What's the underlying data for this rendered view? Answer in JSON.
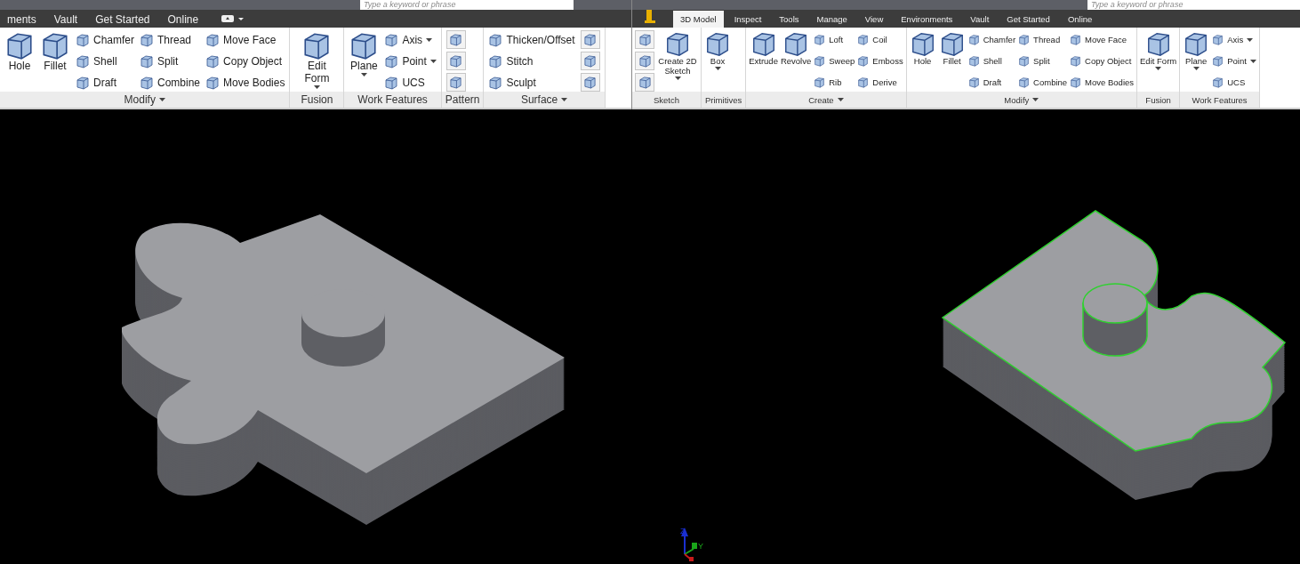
{
  "ribbons": [
    {
      "search": {
        "placeholder": "Type a keyword or phrase"
      },
      "tabs": [
        {
          "label": "ments",
          "selected": false
        },
        {
          "label": "Vault",
          "selected": false
        },
        {
          "label": "Get Started",
          "selected": false
        },
        {
          "label": "Online",
          "selected": false
        }
      ],
      "panels": [
        {
          "label": "Modify",
          "menu": true,
          "columns": [
            {
              "kind": "large",
              "label": "Hole",
              "menu": false
            },
            {
              "kind": "large",
              "label": "Fillet",
              "menu": false
            },
            {
              "kind": "stack",
              "items": [
                {
                  "kind": "text",
                  "label": "Chamfer",
                  "menu": false
                },
                {
                  "kind": "text",
                  "label": "Shell",
                  "menu": false
                },
                {
                  "kind": "text",
                  "label": "Draft",
                  "menu": false
                }
              ]
            },
            {
              "kind": "stack",
              "items": [
                {
                  "kind": "text",
                  "label": "Thread",
                  "menu": false
                },
                {
                  "kind": "text",
                  "label": "Split",
                  "menu": false
                },
                {
                  "kind": "text",
                  "label": "Combine",
                  "menu": false
                }
              ]
            },
            {
              "kind": "stack",
              "items": [
                {
                  "kind": "text",
                  "label": "Move Face",
                  "menu": false
                },
                {
                  "kind": "text",
                  "label": "Copy Object",
                  "menu": false
                },
                {
                  "kind": "text",
                  "label": "Move Bodies",
                  "menu": false
                }
              ]
            }
          ]
        },
        {
          "label": "Fusion",
          "menu": false,
          "columns": [
            {
              "kind": "large",
              "label": "Edit Form",
              "menu": true
            }
          ]
        },
        {
          "label": "Work Features",
          "menu": false,
          "columns": [
            {
              "kind": "large",
              "label": "Plane",
              "menu": true
            },
            {
              "kind": "stack",
              "items": [
                {
                  "kind": "text",
                  "label": "Axis",
                  "menu": true
                },
                {
                  "kind": "text",
                  "label": "Point",
                  "menu": true
                },
                {
                  "kind": "text",
                  "label": "UCS",
                  "menu": false
                }
              ]
            }
          ]
        },
        {
          "label": "Pattern",
          "menu": false,
          "columns": [
            {
              "kind": "stack",
              "items": [
                {
                  "kind": "icon"
                },
                {
                  "kind": "icon"
                },
                {
                  "kind": "icon"
                }
              ]
            }
          ]
        },
        {
          "label": "Surface",
          "menu": true,
          "columns": [
            {
              "kind": "stack",
              "items": [
                {
                  "kind": "text",
                  "label": "Thicken/Offset",
                  "menu": false
                },
                {
                  "kind": "text",
                  "label": "Stitch",
                  "menu": false
                },
                {
                  "kind": "text",
                  "label": "Sculpt",
                  "menu": false
                }
              ]
            },
            {
              "kind": "stack",
              "items": [
                {
                  "kind": "icon"
                },
                {
                  "kind": "icon"
                },
                {
                  "kind": "icon"
                }
              ]
            }
          ]
        }
      ]
    },
    {
      "search": {
        "placeholder": "Type a keyword or phrase"
      },
      "tabs": [
        {
          "label": "3D Model",
          "selected": true
        },
        {
          "label": "Inspect",
          "selected": false
        },
        {
          "label": "Tools",
          "selected": false
        },
        {
          "label": "Manage",
          "selected": false
        },
        {
          "label": "View",
          "selected": false
        },
        {
          "label": "Environments",
          "selected": false
        },
        {
          "label": "Vault",
          "selected": false
        },
        {
          "label": "Get Started",
          "selected": false
        },
        {
          "label": "Online",
          "selected": false
        }
      ],
      "panels": [
        {
          "label": "Sketch",
          "menu": false,
          "columns": [
            {
              "kind": "stack",
              "items": [
                {
                  "kind": "icon"
                },
                {
                  "kind": "icon"
                },
                {
                  "kind": "icon"
                }
              ]
            },
            {
              "kind": "large",
              "label": "Create 2D Sketch",
              "menu": true
            }
          ]
        },
        {
          "label": "Primitives",
          "menu": false,
          "columns": [
            {
              "kind": "large",
              "label": "Box",
              "menu": true
            }
          ]
        },
        {
          "label": "Create",
          "menu": true,
          "columns": [
            {
              "kind": "large",
              "label": "Extrude",
              "menu": false
            },
            {
              "kind": "large",
              "label": "Revolve",
              "menu": false
            },
            {
              "kind": "stack",
              "items": [
                {
                  "kind": "text",
                  "label": "Loft",
                  "menu": false
                },
                {
                  "kind": "text",
                  "label": "Sweep",
                  "menu": false
                },
                {
                  "kind": "text",
                  "label": "Rib",
                  "menu": false
                }
              ]
            },
            {
              "kind": "stack",
              "items": [
                {
                  "kind": "text",
                  "label": "Coil",
                  "menu": false
                },
                {
                  "kind": "text",
                  "label": "Emboss",
                  "menu": false
                },
                {
                  "kind": "text",
                  "label": "Derive",
                  "menu": false
                }
              ]
            }
          ]
        },
        {
          "label": "Modify",
          "menu": true,
          "columns": [
            {
              "kind": "large",
              "label": "Hole",
              "menu": false
            },
            {
              "kind": "large",
              "label": "Fillet",
              "menu": false
            },
            {
              "kind": "stack",
              "items": [
                {
                  "kind": "text",
                  "label": "Chamfer",
                  "menu": false
                },
                {
                  "kind": "text",
                  "label": "Shell",
                  "menu": false
                },
                {
                  "kind": "text",
                  "label": "Draft",
                  "menu": false
                }
              ]
            },
            {
              "kind": "stack",
              "items": [
                {
                  "kind": "text",
                  "label": "Thread",
                  "menu": false
                },
                {
                  "kind": "text",
                  "label": "Split",
                  "menu": false
                },
                {
                  "kind": "text",
                  "label": "Combine",
                  "menu": false
                }
              ]
            },
            {
              "kind": "stack",
              "items": [
                {
                  "kind": "text",
                  "label": "Move Face",
                  "menu": false
                },
                {
                  "kind": "text",
                  "label": "Copy Object",
                  "menu": false
                },
                {
                  "kind": "text",
                  "label": "Move Bodies",
                  "menu": false
                }
              ]
            }
          ]
        },
        {
          "label": "Fusion",
          "menu": false,
          "columns": [
            {
              "kind": "large",
              "label": "Edit Form",
              "menu": true
            }
          ]
        },
        {
          "label": "Work Features",
          "menu": false,
          "columns": [
            {
              "kind": "large",
              "label": "Plane",
              "menu": true
            },
            {
              "kind": "stack",
              "items": [
                {
                  "kind": "text",
                  "label": "Axis",
                  "menu": true
                },
                {
                  "kind": "text",
                  "label": "Point",
                  "menu": true
                },
                {
                  "kind": "text",
                  "label": "UCS",
                  "menu": false
                }
              ]
            }
          ]
        }
      ]
    }
  ],
  "viewport": {
    "axes": [
      {
        "label": "Z"
      },
      {
        "label": "Y"
      }
    ]
  }
}
